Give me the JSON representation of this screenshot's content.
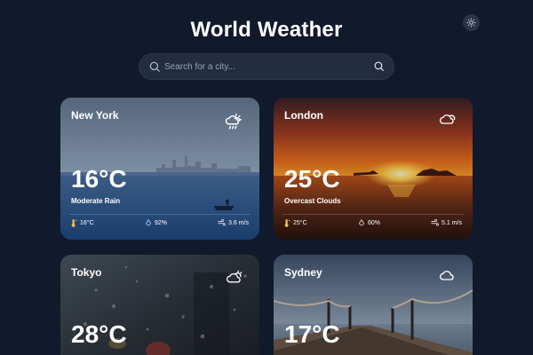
{
  "header": {
    "title": "World Weather",
    "theme_icon": "sun-icon"
  },
  "search": {
    "placeholder": "Search for a city...",
    "value": ""
  },
  "cards": [
    {
      "city": "New York",
      "temperature": "16°C",
      "condition": "Moderate Rain",
      "weather_icon": "rain-cloud-sun-icon",
      "stats": {
        "feels_like": "16°C",
        "humidity": "92%",
        "wind": "3.6 m/s"
      }
    },
    {
      "city": "London",
      "temperature": "25°C",
      "condition": "Overcast Clouds",
      "weather_icon": "cloud-icon",
      "stats": {
        "feels_like": "25°C",
        "humidity": "60%",
        "wind": "5.1 m/s"
      }
    },
    {
      "city": "Tokyo",
      "temperature": "28°C",
      "weather_icon": "cloud-sun-icon"
    },
    {
      "city": "Sydney",
      "temperature": "17°C",
      "weather_icon": "cloud-icon"
    }
  ],
  "colors": {
    "background": "#111a2c",
    "search_bg": "#222d40",
    "accent_thermo": "#f2c14e",
    "humidity_icon": "#9fc4ff"
  }
}
